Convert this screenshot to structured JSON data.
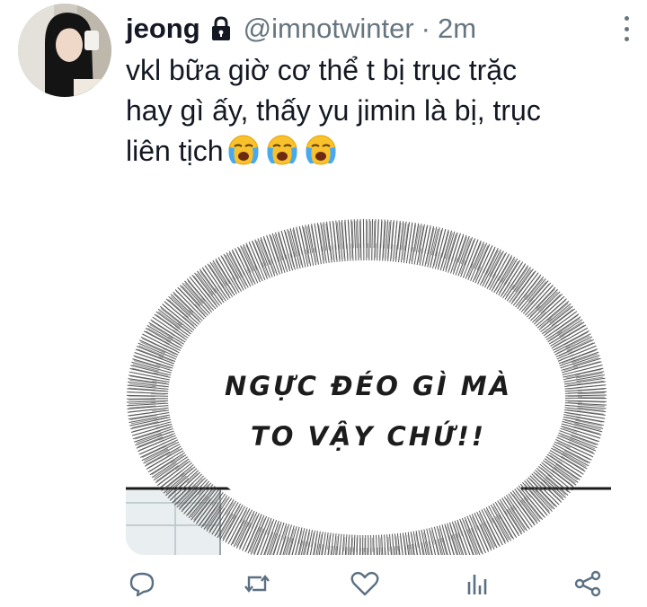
{
  "tweet": {
    "display_name": "jeong",
    "handle": "@imnotwinter",
    "separator": "·",
    "timestamp": "2m",
    "text_lines": [
      "vkl bữa giờ cơ thể t bị trục trặc",
      "hay gì ấy, thấy yu jimin là bị, trục",
      "liên tịch"
    ],
    "emoji": [
      "😭",
      "😭",
      "😭"
    ]
  },
  "media": {
    "speech_lines": [
      "NGỰC ĐÉO GÌ MÀ",
      "TO VẬY CHỨ!!"
    ]
  },
  "icons": {
    "lock": "lock-icon",
    "more": "more-vertical-icon",
    "reply": "reply-icon",
    "retweet": "retweet-icon",
    "like": "heart-icon",
    "analytics": "analytics-icon",
    "share": "share-icon"
  },
  "colors": {
    "text": "#141823",
    "muted": "#66757f",
    "icon": "#5b7083"
  }
}
